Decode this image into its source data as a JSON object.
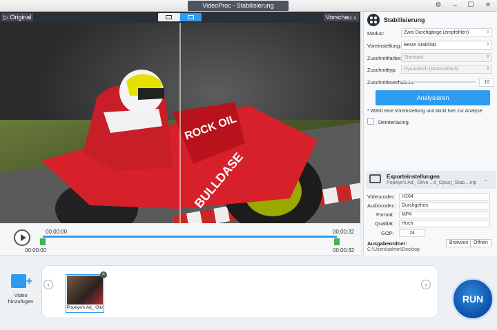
{
  "window": {
    "title": "VideoProc - Stabilisierung"
  },
  "preview": {
    "original_label": "Original",
    "preview_label": "Vorschau"
  },
  "timeline": {
    "start_top": "00:00:00",
    "end_top": "00:00:32",
    "start_bottom": "00:00:00",
    "end_bottom": "00:00:32"
  },
  "stabilization": {
    "title": "Stabilisierung",
    "mode_label": "Modus:",
    "mode_value": "Zwei Durchgänge (empfohlen)",
    "preset_label": "Voreinstellung:",
    "preset_value": "Beste Stabilität",
    "cropcolor_label": "Zuschnittfarbe:",
    "cropcolor_value": "Standard",
    "croptype_label": "Zuschnitttyp:",
    "croptype_value": "Dynamisch (Automatisch)",
    "cropratio_label": "Zuschnittsverhältnis:",
    "cropratio_value": "10",
    "analyze_label": "Analysieren",
    "hint": "* Wählt eine Voreinstellung und klickt hier zur Analyse",
    "deinterlace_label": "Deinterlacing"
  },
  "export": {
    "title": "Exporteinstellungen",
    "subtitle": "Popeye's Ad_ Olive ...it_Opus)_Stab....mp4",
    "videocodec_label": "Videocodec:",
    "videocodec_value": "H264",
    "audiocodec_label": "Audiocodec:",
    "audiocodec_value": "Durchgehen",
    "format_label": "Format:",
    "format_value": "MP4",
    "quality_label": "Qualität:",
    "quality_value": "Hoch",
    "gop_label": "GOP:",
    "gop_value": "24",
    "output_label": "Ausgabeordner:",
    "output_path": "C:\\Users\\admin\\Desktop",
    "browse_label": "Browsen",
    "open_label": "Öffnen"
  },
  "bottom": {
    "add_video_label": "Video hinzufügen",
    "thumb_caption": "Popeye's Ad_ Oliv",
    "run_label": "RUN"
  },
  "colors": {
    "accent": "#2d9bf0",
    "handle": "#4caf50",
    "run": "#0d4fa6"
  }
}
